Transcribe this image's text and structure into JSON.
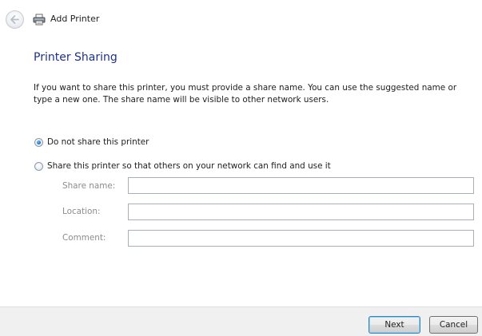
{
  "window": {
    "title": "Add Printer"
  },
  "icons": {
    "back": "back-arrow-icon",
    "printer": "printer-icon"
  },
  "page": {
    "heading": "Printer Sharing",
    "description": "If you want to share this printer, you must provide a share name. You can use the suggested name or type a new one. The share name will be visible to other network users."
  },
  "sharing_options": [
    {
      "label": "Do not share this printer",
      "checked": true
    },
    {
      "label": "Share this printer so that others on your network can find and use it",
      "checked": false
    }
  ],
  "fields": {
    "share_name": {
      "label": "Share name:",
      "value": ""
    },
    "location": {
      "label": "Location:",
      "value": ""
    },
    "comment": {
      "label": "Comment:",
      "value": ""
    }
  },
  "buttons": {
    "next": "Next",
    "cancel": "Cancel"
  },
  "colors": {
    "heading": "#1e3287",
    "disabled_label": "#8c8c8c",
    "footer_bg": "#f0f0f0"
  }
}
